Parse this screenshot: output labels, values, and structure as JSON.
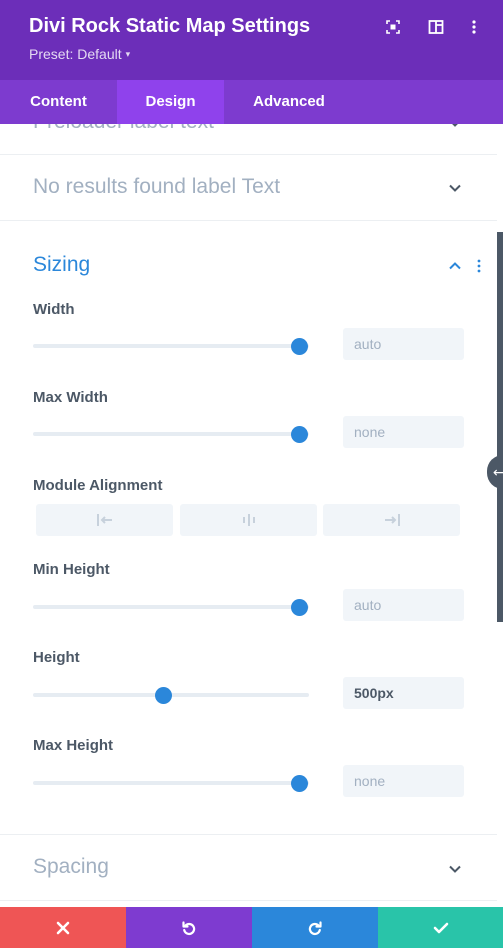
{
  "header": {
    "title": "Divi Rock Static Map Settings",
    "preset": "Preset: Default",
    "icons": [
      "expand-icon",
      "sidebar-layout-icon",
      "more-vertical-icon"
    ]
  },
  "tabs": [
    {
      "label": "Content",
      "active": false
    },
    {
      "label": "Design",
      "active": true
    },
    {
      "label": "Advanced",
      "active": false
    }
  ],
  "sections": {
    "preloader": "Preloader label text",
    "no_results": "No results found label Text",
    "sizing": "Sizing",
    "spacing": "Spacing"
  },
  "fields": {
    "width": {
      "label": "Width",
      "value": "auto",
      "slider": 1.0
    },
    "max_width": {
      "label": "Max Width",
      "value": "none",
      "slider": 1.0
    },
    "alignment": {
      "label": "Module Alignment",
      "options": [
        "align-left-icon",
        "align-center-icon",
        "align-right-icon"
      ]
    },
    "min_height": {
      "label": "Min Height",
      "value": "auto",
      "slider": 1.0
    },
    "height": {
      "label": "Height",
      "value": "500px",
      "slider": 0.47
    },
    "max_height": {
      "label": "Max Height",
      "value": "none",
      "slider": 1.0
    }
  },
  "footer": {
    "buttons": [
      "close-icon",
      "undo-icon",
      "redo-icon",
      "check-icon"
    ],
    "colors": {
      "cancel": "#ef5555",
      "undo": "#7e3bd0",
      "redo": "#2b87da",
      "save": "#29c4a9"
    }
  },
  "colors": {
    "header": "#6c2eb9",
    "tabs": "#7d3bcf",
    "active_tab": "#8f42ec",
    "accent": "#2b87da"
  }
}
